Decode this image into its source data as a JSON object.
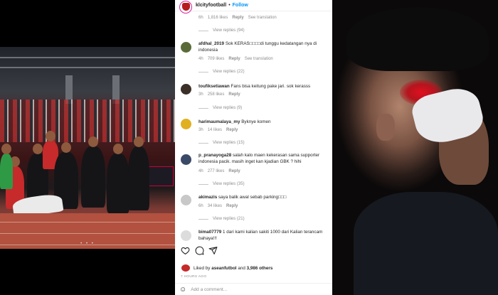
{
  "post": {
    "username": "klcityfootball",
    "separator": "•",
    "follow_label": "Follow"
  },
  "comments": [
    {
      "meta": {
        "time": "6h",
        "likes": "1,816 likes",
        "reply": "Reply",
        "translate": "See translation"
      },
      "view_replies": "View replies (94)"
    },
    {
      "user": "afdhal_2019",
      "text": "Sok KERAS□□□□di tunggu kedatangan nya di indonesia",
      "meta": {
        "time": "4h",
        "likes": "709 likes",
        "reply": "Reply",
        "translate": "See translation"
      },
      "view_replies": "View replies (22)",
      "avatar_color": "#5a6b3a"
    },
    {
      "user": "toufiksetiawan",
      "text": "Fans bisa keitung pake jari. sok kerasss",
      "meta": {
        "time": "3h",
        "likes": "258 likes",
        "reply": "Reply"
      },
      "view_replies": "View replies (9)",
      "avatar_color": "#3b3028"
    },
    {
      "user": "harimaumalaya_my",
      "text": "Byknye komen",
      "meta": {
        "time": "3h",
        "likes": "14 likes",
        "reply": "Reply"
      },
      "view_replies": "View replies (15)",
      "avatar_color": "#e0b020"
    },
    {
      "user": "p_pranayoga28",
      "text": "salah kalo maen kekerasan sama supporter indonesia pacik. masih inget kan kjadian GBK ? hihi",
      "meta": {
        "time": "4h",
        "likes": "277 likes",
        "reply": "Reply"
      },
      "view_replies": "View replies (35)",
      "avatar_color": "#3a4a66"
    },
    {
      "user": "akimazis",
      "text": "saya balik awal sebab parking□□□",
      "meta": {
        "time": "6h",
        "likes": "34 likes",
        "reply": "Reply"
      },
      "view_replies": "View replies (21)",
      "avatar_color": "#c8c8c8"
    },
    {
      "user": "bima07779",
      "text": "1 dari kami kalian sakiti 1000 dari Kalian terancam bahaya!!!",
      "avatar_color": "#dcdcdc"
    }
  ],
  "likes": {
    "prefix": "Liked by",
    "user": "aseanfutbol",
    "and": "and",
    "others": "3,986 others"
  },
  "time_ago": "7 HOURS AGO",
  "add_comment_placeholder": "Add a comment...",
  "photo_dots": "• • •",
  "icons": [
    "heart-icon",
    "comment-icon",
    "share-icon",
    "emoji-icon"
  ],
  "colors": {
    "follow": "#0095f6",
    "wound": "#e01020",
    "brand_red": "#b71c1c"
  }
}
